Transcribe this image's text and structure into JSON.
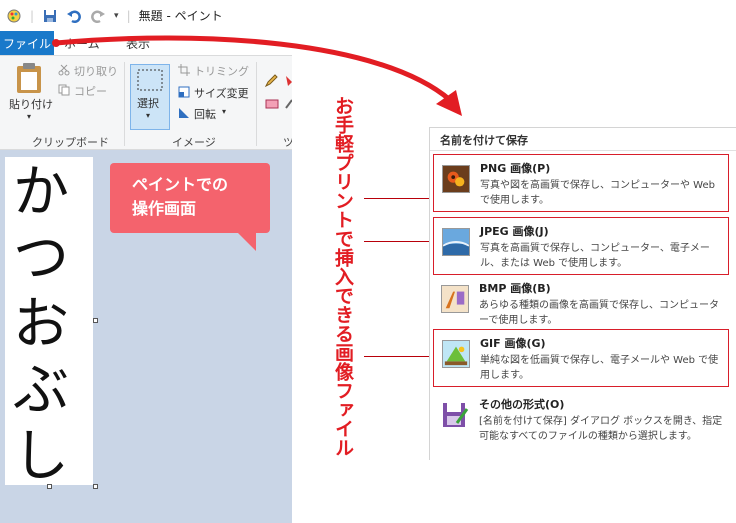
{
  "titlebar": {
    "title": "無題 - ペイント"
  },
  "menubar": {
    "file": "ファイル",
    "home": "ホーム",
    "view": "表示"
  },
  "ribbon": {
    "paste": "貼り付け",
    "cut": "切り取り",
    "copy": "コピー",
    "clipboard_group": "クリップボード",
    "select": "選択",
    "trim": "トリミング",
    "resize": "サイズ変更",
    "rotate": "回転",
    "image_group": "イメージ",
    "tools_group_partial": "ツ"
  },
  "canvas": {
    "chars": [
      "か",
      "つ",
      "お",
      "ぶ",
      "し"
    ]
  },
  "callout": {
    "line1": "ペイントでの",
    "line2": "操作画面"
  },
  "annotation": "お手軽プリントで挿入できる画像ファイル",
  "save_menu": {
    "title": "名前を付けて保存",
    "items": [
      {
        "title": "PNG 画像(P)",
        "desc": "写真や図を高画質で保存し、コンピューターや Web で使用します。",
        "icon": "png-icon"
      },
      {
        "title": "JPEG 画像(J)",
        "desc": "写真を高画質で保存し、コンピューター、電子メール、または Web で使用します。",
        "icon": "jpeg-icon"
      },
      {
        "title": "BMP 画像(B)",
        "desc": "あらゆる種類の画像を高画質で保存し、コンピューターで使用します。",
        "icon": "bmp-icon"
      },
      {
        "title": "GIF 画像(G)",
        "desc": "単純な図を低画質で保存し、電子メールや Web で使用します。",
        "icon": "gif-icon"
      },
      {
        "title": "その他の形式(O)",
        "desc": "[名前を付けて保存] ダイアログ ボックスを開き、指定可能なすべてのファイルの種類から選択します。",
        "icon": "other-formats-icon"
      }
    ]
  },
  "colors": {
    "accent": "#1979ca",
    "callout": "#f4636d",
    "annotation": "#e21d23",
    "highlight": "#d81e2a"
  }
}
